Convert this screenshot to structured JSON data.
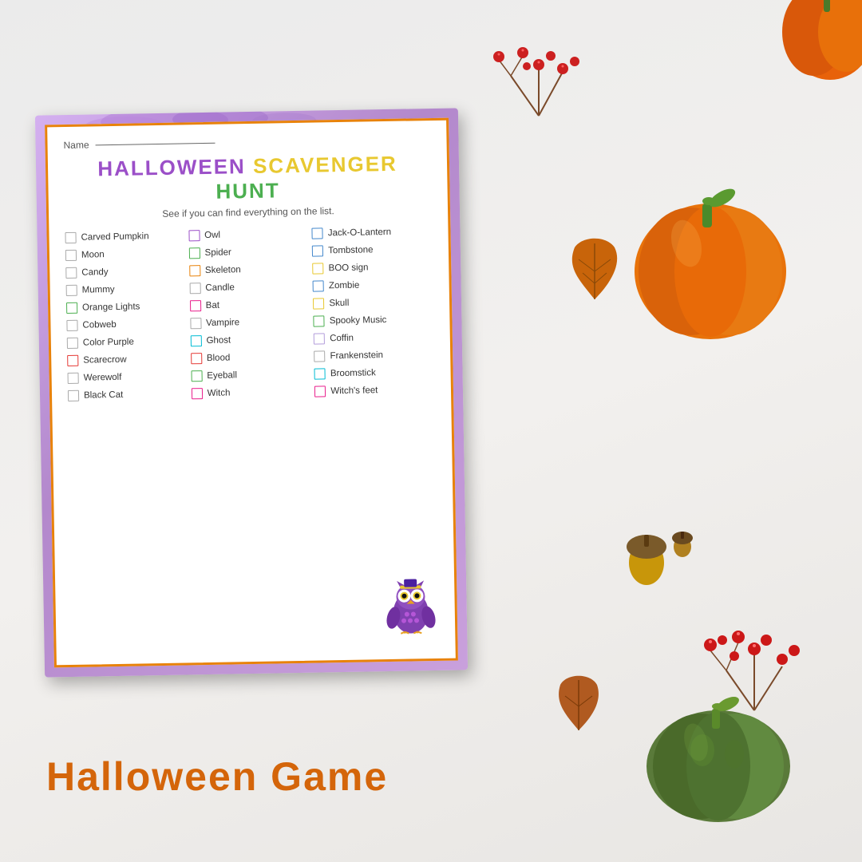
{
  "background": {
    "color": "#f0eeec"
  },
  "bottom_label": "Halloween Game",
  "name_label": "Name",
  "paper": {
    "title": {
      "part1": "HALLOWEEN",
      "part2": "SCAVENGER",
      "part3": "HUNT"
    },
    "subtitle": "See if you can find everything on the list.",
    "items": [
      {
        "label": "Carved Pumpkin",
        "color": "white"
      },
      {
        "label": "Owl",
        "color": "purple"
      },
      {
        "label": "Jack-O-Lantern",
        "color": "blue"
      },
      {
        "label": "Moon",
        "color": "white"
      },
      {
        "label": "Spider",
        "color": "green"
      },
      {
        "label": "Tombstone",
        "color": "blue"
      },
      {
        "label": "Candy",
        "color": "white"
      },
      {
        "label": "Skeleton",
        "color": "orange"
      },
      {
        "label": "BOO sign",
        "color": "yellow"
      },
      {
        "label": "Mummy",
        "color": "white"
      },
      {
        "label": "Candle",
        "color": "white"
      },
      {
        "label": "Zombie",
        "color": "blue"
      },
      {
        "label": "Orange Lights",
        "color": "green"
      },
      {
        "label": "Bat",
        "color": "pink"
      },
      {
        "label": "Skull",
        "color": "yellow"
      },
      {
        "label": "Cobweb",
        "color": "white"
      },
      {
        "label": "Vampire",
        "color": "white"
      },
      {
        "label": "Spooky Music",
        "color": "green"
      },
      {
        "label": "Color Purple",
        "color": "white"
      },
      {
        "label": "Ghost",
        "color": "cyan"
      },
      {
        "label": "Coffin",
        "color": "lavender"
      },
      {
        "label": "Scarecrow",
        "color": "red"
      },
      {
        "label": "Blood",
        "color": "red"
      },
      {
        "label": "Frankenstein",
        "color": "white"
      },
      {
        "label": "Werewolf",
        "color": "white"
      },
      {
        "label": "Eyeball",
        "color": "green"
      },
      {
        "label": "Broomstick",
        "color": "cyan"
      },
      {
        "label": "Black Cat",
        "color": "white"
      },
      {
        "label": "Witch",
        "color": "pink"
      },
      {
        "label": "Witch's feet",
        "color": "pink"
      }
    ]
  }
}
